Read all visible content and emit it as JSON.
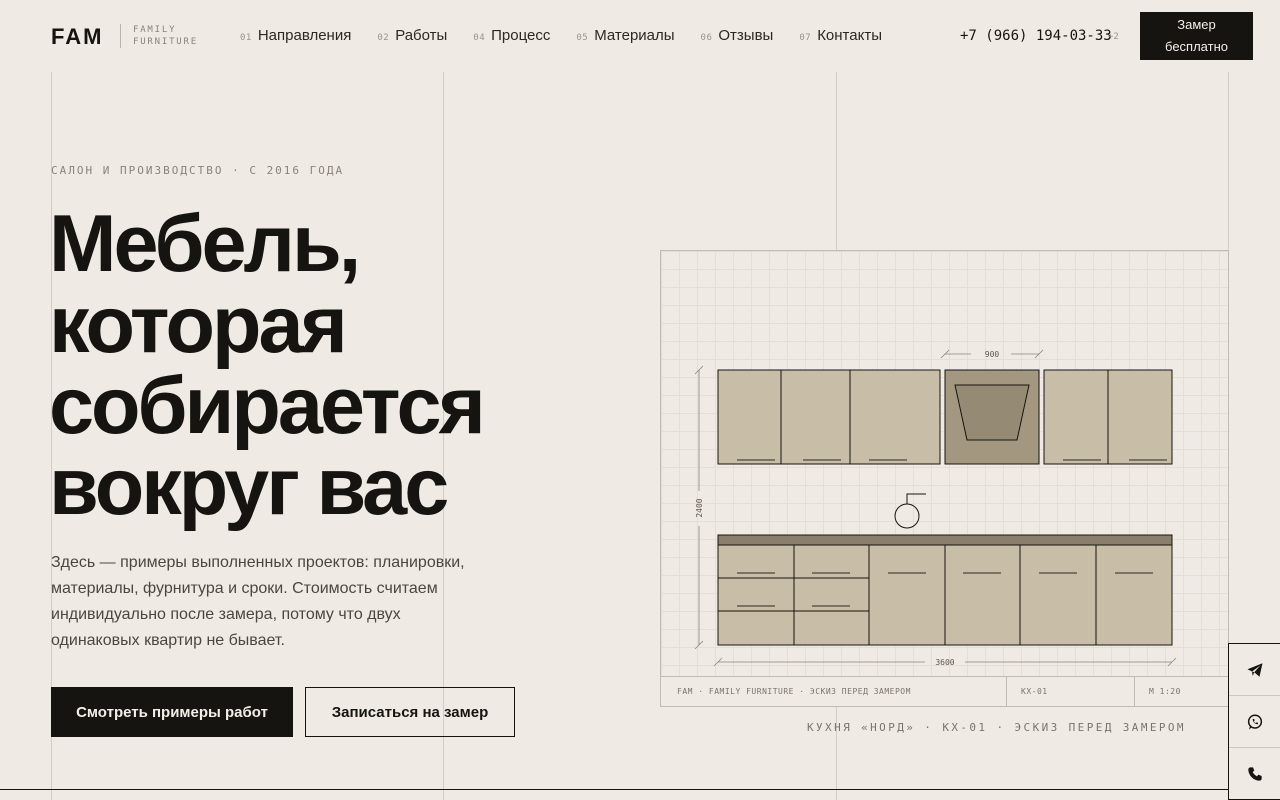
{
  "header": {
    "logo": "FAM",
    "logo_sub_1": "FAMILY",
    "logo_sub_2": "FURNITURE",
    "nav": [
      {
        "num": "01",
        "label": "Направления"
      },
      {
        "num": "02",
        "label": "Работы"
      },
      {
        "num": "04",
        "label": "Процесс"
      },
      {
        "num": "05",
        "label": "Материалы"
      },
      {
        "num": "06",
        "label": "Отзывы"
      },
      {
        "num": "07",
        "label": "Контакты"
      }
    ],
    "phone": "+7 (966) 194-03-33",
    "phone_extra": "+2",
    "cta_line1": "Замер",
    "cta_line2": "бесплатно"
  },
  "hero": {
    "eyebrow": "САЛОН И ПРОИЗВОДСТВО · С 2016 ГОДА",
    "title_lines": [
      "Мебель,",
      "которая",
      "собирается",
      "вокруг вас"
    ],
    "lead": "Здесь — примеры выполненных проектов: планировки, материалы, фурнитура и сроки. Стоимость считаем индивидуально после замера, потому что двух одинаковых квартир не бывает.",
    "btn_primary": "Смотреть примеры работ",
    "btn_secondary": "Записаться на замер"
  },
  "drawing": {
    "dim_top": "900",
    "dim_side": "2400",
    "dim_bottom": "3600",
    "stamp_title": "FAM · FAMILY FURNITURE · ЭСКИЗ ПЕРЕД ЗАМЕРОМ",
    "stamp_code": "КХ-01",
    "stamp_scale": "М 1:20",
    "caption": "КУХНЯ «НОРД» · КХ-01 · ЭСКИЗ ПЕРЕД ЗАМЕРОМ"
  },
  "side": {
    "icons": [
      "telegram-icon",
      "whatsapp-icon",
      "phone-icon"
    ]
  },
  "colors": {
    "background": "#efebe4",
    "ink": "#161410",
    "cabinet": "#c8bda6",
    "hood": "#a39780",
    "countertop": "#8a7f6c"
  }
}
